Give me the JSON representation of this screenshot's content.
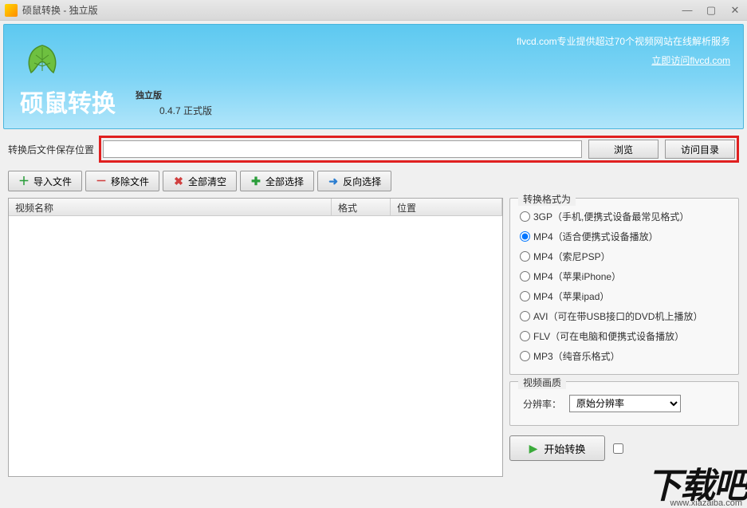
{
  "window": {
    "title": "硕鼠转换 - 独立版"
  },
  "banner": {
    "tagline": "flvcd.com专业提供超过70个视频网站在线解析服务",
    "link": "立即访问flvcd.com",
    "title": "硕鼠转换",
    "edition": "独立版",
    "version": "0.4.7 正式版"
  },
  "path": {
    "label": "转换后文件保存位置",
    "value": "",
    "browse": "浏览",
    "open_dir": "访问目录"
  },
  "toolbar": {
    "import": "导入文件",
    "remove": "移除文件",
    "clear": "全部清空",
    "select_all": "全部选择",
    "invert": "反向选择"
  },
  "list": {
    "col_name": "视频名称",
    "col_format": "格式",
    "col_location": "位置"
  },
  "formats": {
    "group_title": "转换格式为",
    "options": [
      {
        "id": "3gp",
        "label": "3GP（手机,便携式设备最常见格式）"
      },
      {
        "id": "mp4-portable",
        "label": "MP4（适合便携式设备播放）"
      },
      {
        "id": "mp4-psp",
        "label": "MP4（索尼PSP）"
      },
      {
        "id": "mp4-iphone",
        "label": "MP4（苹果iPhone）"
      },
      {
        "id": "mp4-ipad",
        "label": "MP4（苹果ipad）"
      },
      {
        "id": "avi",
        "label": "AVI（可在带USB接口的DVD机上播放）"
      },
      {
        "id": "flv",
        "label": "FLV（可在电脑和便携式设备播放）"
      },
      {
        "id": "mp3",
        "label": "MP3（纯音乐格式）"
      }
    ],
    "selected": "mp4-portable"
  },
  "quality": {
    "group_title": "视频画质",
    "label": "分辨率：",
    "value": "原始分辨率"
  },
  "start": {
    "label": "开始转换"
  },
  "watermark": {
    "text": "下载吧",
    "url": "www.xiazaiba.com"
  }
}
